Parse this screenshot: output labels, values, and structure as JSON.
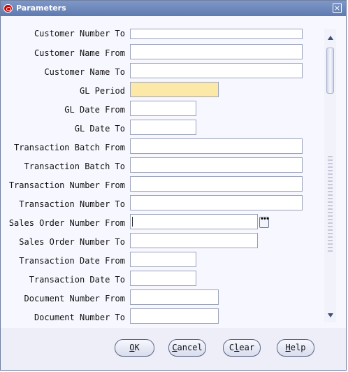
{
  "window": {
    "title": "Parameters",
    "close": "×"
  },
  "fields": [
    {
      "label": "Customer Number To",
      "value": ""
    },
    {
      "label": "Customer Name From",
      "value": ""
    },
    {
      "label": "Customer Name To",
      "value": ""
    },
    {
      "label": "GL Period",
      "value": ""
    },
    {
      "label": "GL Date From",
      "value": ""
    },
    {
      "label": "GL Date To",
      "value": ""
    },
    {
      "label": "Transaction Batch From",
      "value": ""
    },
    {
      "label": "Transaction Batch To",
      "value": ""
    },
    {
      "label": "Transaction Number From",
      "value": ""
    },
    {
      "label": "Transaction Number To",
      "value": ""
    },
    {
      "label": "Sales Order Number From",
      "value": ""
    },
    {
      "label": "Sales Order Number To",
      "value": ""
    },
    {
      "label": "Transaction Date From",
      "value": ""
    },
    {
      "label": "Transaction Date To",
      "value": ""
    },
    {
      "label": "Document Number From",
      "value": ""
    },
    {
      "label": "Document Number To",
      "value": ""
    }
  ],
  "buttons": {
    "ok": {
      "mnemonic": "O",
      "rest": "K"
    },
    "cancel": {
      "mnemonic": "C",
      "rest": "ancel"
    },
    "clear": {
      "mnemonic": "l",
      "prefix": "C",
      "rest": "ear"
    },
    "help": {
      "mnemonic": "H",
      "rest": "elp"
    }
  },
  "lov_icon": "ellipsis-icon",
  "colors": {
    "titlebar": "#5f7ab0",
    "required_field": "#fce8a7"
  }
}
